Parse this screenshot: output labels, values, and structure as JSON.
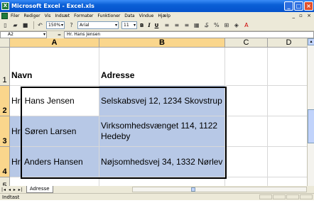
{
  "window": {
    "title": "Microsoft Excel - Excel.xls",
    "buttons": [
      "_",
      "□",
      "×"
    ]
  },
  "menubar": {
    "items": [
      "Filer",
      "Rediger",
      "Vis",
      "Indsæt",
      "Formater",
      "Funktioner",
      "Data",
      "Vindue",
      "Hjælp"
    ]
  },
  "toolbar": {
    "zoom": "150%",
    "font": "Arial",
    "size": "11",
    "bold": "B",
    "italic": "I",
    "underline": "U"
  },
  "formula_bar": {
    "namebox": "A2",
    "fx": "=",
    "content": "Hr. Hans Jensen"
  },
  "sheet": {
    "columns": [
      "A",
      "B",
      "C",
      "D"
    ],
    "rows": [
      "1",
      "2",
      "3",
      "4",
      "5"
    ],
    "header": {
      "a": "Navn",
      "b": "Adresse"
    },
    "data": [
      {
        "name": "Hr. Hans Jensen",
        "addr": "Selskabsvej 12, 1234 Skovstrup"
      },
      {
        "name": "Hr. Søren Larsen",
        "addr": "Virksomhedsvænget 114, 1122 Hedeby"
      },
      {
        "name": "Hr. Anders Hansen",
        "addr": "Nøjsomhedsvej 34, 1332 Nørlev"
      }
    ]
  },
  "tabs": {
    "nav": "|◂ ◂ ▸ ▸|",
    "active": "Adresse"
  },
  "status": {
    "text": "Indtast"
  },
  "colors": {
    "title": "#0a5fd6",
    "selection": "#b7c8e6",
    "header_highlight": "#fad68c"
  }
}
